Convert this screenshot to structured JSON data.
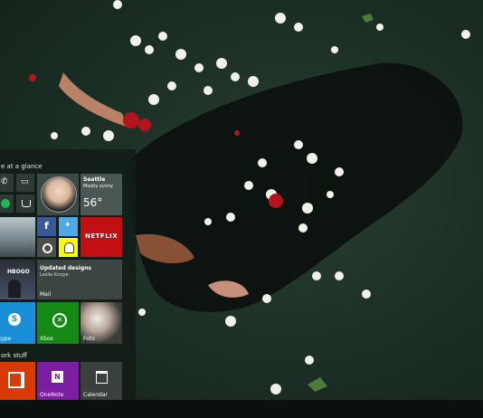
{
  "start_menu": {
    "group1_label": "e at a glance",
    "group2_label": "ork stuff",
    "weather": {
      "city": "Seattle",
      "condition": "Mostly sunny",
      "temp": "56°"
    },
    "people_tile": {
      "title": "Updated designs",
      "sender": "Leslie Knope"
    },
    "mail_label": "Mail",
    "skype_label": "kype",
    "xbox_label": "Xbox",
    "photos_label": "Foto",
    "netflix_label": "NETFLIX",
    "hbo_label": "HBOGO",
    "office_label": "",
    "onenote_label": "OneNote",
    "calendar_label": "Calendar"
  },
  "colors": {
    "start_bg": "#121c18",
    "skype": "#1a8ed6",
    "xbox": "#148a14",
    "netflix": "#c20f14",
    "office": "#d83b01",
    "onenote": "#7a1fa0",
    "facebook": "#3b5998",
    "twitter": "#4ea9e6",
    "snapchat": "#fffc00"
  }
}
